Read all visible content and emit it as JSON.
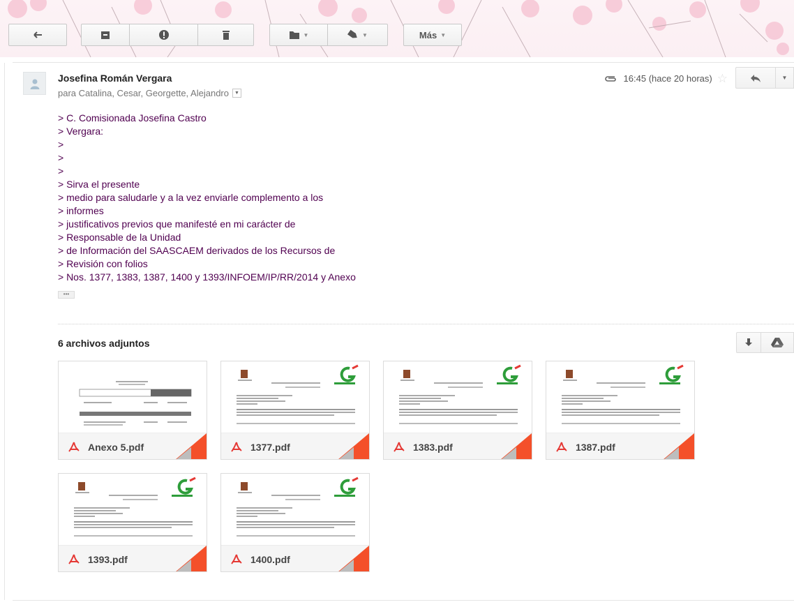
{
  "toolbar": {
    "more_label": "Más"
  },
  "message": {
    "sender": "Josefina Román Vergara",
    "recipients": "para Catalina, Cesar, Georgette, Alejandro",
    "time": "16:45 (hace 20 horas)",
    "body": [
      "> C. Comisionada Josefina Castro",
      "> Vergara:",
      ">",
      ">",
      ">",
      "> Sirva el presente",
      "> medio para saludarle y a la vez enviarle complemento a los",
      "> informes",
      "> justificativos previos que manifesté en mi carácter de",
      "> Responsable de la Unidad",
      "> de Información del SAASCAEM derivados de los Recursos de",
      "> Revisión con folios",
      "> Nos. 1377, 1383, 1387, 1400 y 1393/INFOEM/IP/RR/2014 y Anexo"
    ]
  },
  "attachments": {
    "count_label": "6 archivos adjuntos",
    "files": [
      {
        "name": "Anexo 5.pdf"
      },
      {
        "name": "1377.pdf"
      },
      {
        "name": "1383.pdf"
      },
      {
        "name": "1387.pdf"
      },
      {
        "name": "1393.pdf"
      },
      {
        "name": "1400.pdf"
      }
    ]
  },
  "colors": {
    "accent_corner": "#f4502a",
    "quoted_text": "#500050",
    "theme_pink": "#f7c6d6"
  }
}
